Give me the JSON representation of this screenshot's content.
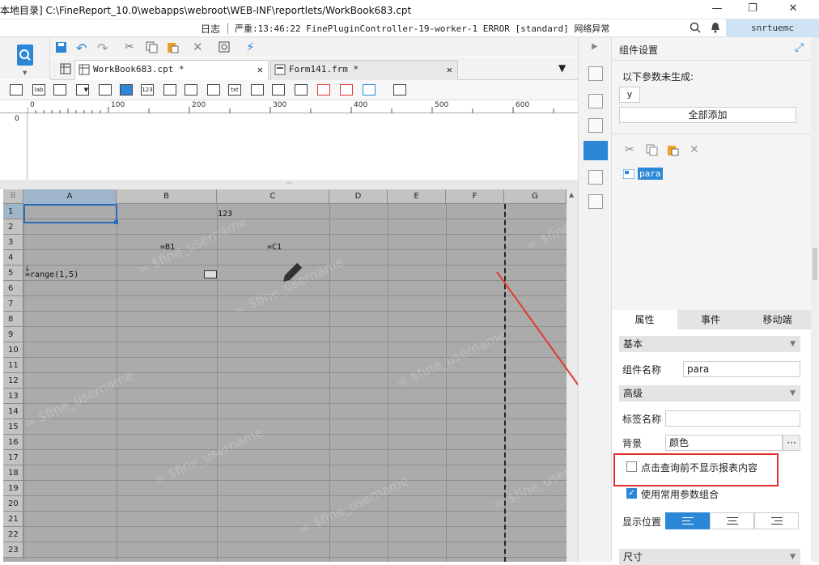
{
  "window": {
    "title": "本地目录]   C:\\FineReport_10.0\\webapps\\webroot\\WEB-INF\\reportlets/WorkBook683.cpt",
    "min": "—",
    "max": "❐",
    "close": "✕"
  },
  "status": {
    "log_label": "日志",
    "message": "严重:13:46:22 FinePluginController-19-worker-1 ERROR [standard] 网络异常",
    "user": "snrtuemc"
  },
  "tabs": [
    {
      "label": "WorkBook683.cpt *"
    },
    {
      "label": "Form141.frm *"
    }
  ],
  "ruler": {
    "marks": [
      "0",
      "100",
      "200",
      "300",
      "400",
      "500",
      "600"
    ],
    "vmark": "0"
  },
  "grid": {
    "columns": [
      "A",
      "B",
      "C",
      "D",
      "E",
      "F",
      "G"
    ],
    "rows": [
      "1",
      "2",
      "3",
      "4",
      "5",
      "6",
      "7",
      "8",
      "9",
      "10",
      "11",
      "12",
      "13",
      "14",
      "15",
      "16",
      "17",
      "18",
      "19",
      "20",
      "21",
      "22",
      "23"
    ],
    "cells": {
      "b1_c1": "123",
      "b3": "=B1",
      "c3": "=C1",
      "a5": "=range(1,5)"
    },
    "watermark": "= $fine_username"
  },
  "panel": {
    "title": "组件设置",
    "params_label": "以下参数未生成:",
    "param_chip": "y",
    "add_all": "全部添加",
    "tree_item": "para",
    "tabs": [
      "属性",
      "事件",
      "移动端"
    ],
    "sections": {
      "basic": "基本",
      "advanced": "高级",
      "size": "尺寸"
    },
    "widget_name_label": "组件名称",
    "widget_name_value": "para",
    "label_name_label": "标签名称",
    "label_name_value": "",
    "bg_label": "背景",
    "bg_value": "颜色",
    "bg_more": "···",
    "chk_no_show": "点击查询前不显示报表内容",
    "chk_common": "使用常用参数组合",
    "position_label": "显示位置"
  },
  "colors": {
    "accent": "#2c87d6",
    "highlight_border": "#e03030",
    "arrow": "#e53935"
  }
}
